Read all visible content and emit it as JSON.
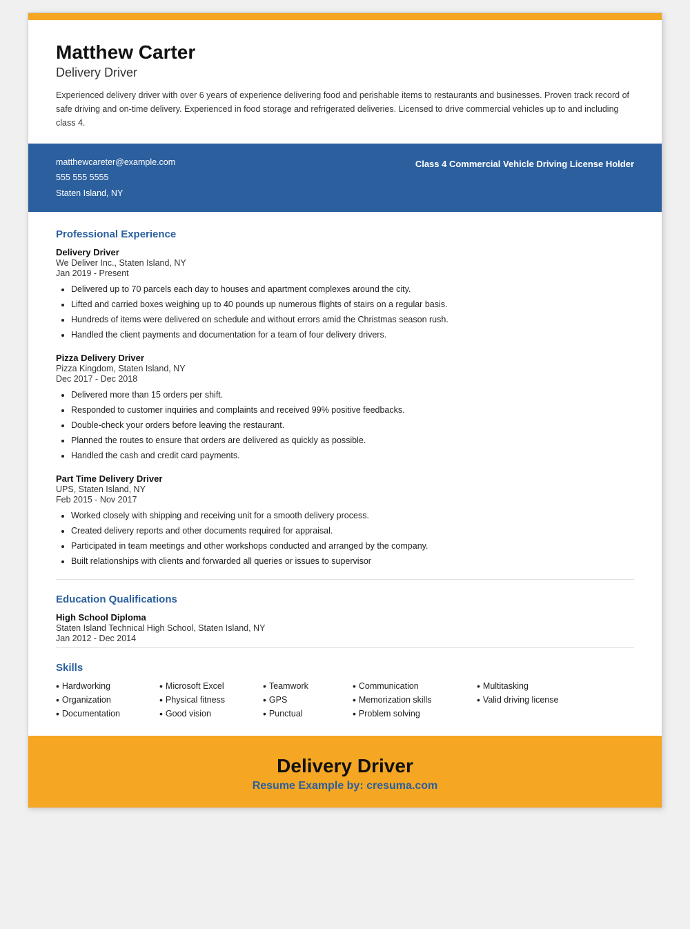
{
  "candidate": {
    "name": "Matthew Carter",
    "title": "Delivery Driver",
    "summary": "Experienced delivery driver with over 6 years of experience delivering food and perishable items to restaurants and businesses. Proven track record of safe driving and on-time delivery. Experienced in food storage and refrigerated deliveries. Licensed to drive commercial vehicles up to and including class 4."
  },
  "contact": {
    "email": "matthewcareter@example.com",
    "phone": "555 555 5555",
    "location": "Staten Island, NY",
    "badge": "Class 4 Commercial Vehicle Driving License Holder"
  },
  "sections": {
    "experience_title": "Professional Experience",
    "education_title": "Education Qualifications",
    "skills_title": "Skills"
  },
  "experience": [
    {
      "job_title": "Delivery Driver",
      "company": "We Deliver Inc., Staten Island, NY",
      "dates": "Jan 2019 - Present",
      "bullets": [
        "Delivered up to 70 parcels each day to houses and apartment complexes around the city.",
        "Lifted and carried boxes weighing up to 40 pounds up numerous flights of stairs on a regular basis.",
        "Hundreds of items were delivered on schedule and without errors amid the Christmas season rush.",
        "Handled the client payments and documentation for a team of four delivery drivers."
      ]
    },
    {
      "job_title": "Pizza Delivery Driver",
      "company": "Pizza Kingdom, Staten Island, NY",
      "dates": "Dec 2017 - Dec 2018",
      "bullets": [
        "Delivered more than 15 orders per shift.",
        "Responded to customer inquiries and complaints and received 99% positive feedbacks.",
        "Double-check your orders before leaving the restaurant.",
        "Planned the routes to ensure that orders are delivered as quickly as possible.",
        "Handled the cash and credit card payments."
      ]
    },
    {
      "job_title": "Part Time Delivery Driver",
      "company": "UPS, Staten Island, NY",
      "dates": "Feb 2015 - Nov 2017",
      "bullets": [
        "Worked closely with shipping and receiving unit for a smooth delivery process.",
        "Created delivery reports and other documents required for appraisal.",
        "Participated in team meetings and other workshops conducted and arranged by the company.",
        "Built relationships with clients and forwarded all queries or issues to supervisor"
      ]
    }
  ],
  "education": [
    {
      "degree": "High School Diploma",
      "school": "Staten Island Technical High School, Staten Island, NY",
      "dates": "Jan 2012 - Dec 2014"
    }
  ],
  "skills": [
    {
      "col": 0,
      "name": "Hardworking"
    },
    {
      "col": 1,
      "name": "Microsoft Excel"
    },
    {
      "col": 2,
      "name": "Teamwork"
    },
    {
      "col": 3,
      "name": "Communication"
    },
    {
      "col": 4,
      "name": "Multitasking"
    },
    {
      "col": 0,
      "name": "Organization"
    },
    {
      "col": 1,
      "name": "Physical fitness"
    },
    {
      "col": 2,
      "name": "GPS"
    },
    {
      "col": 3,
      "name": "Memorization skills"
    },
    {
      "col": 4,
      "name": "Valid driving license"
    },
    {
      "col": 0,
      "name": "Documentation"
    },
    {
      "col": 1,
      "name": "Good vision"
    },
    {
      "col": 2,
      "name": "Punctual"
    },
    {
      "col": 3,
      "name": "Problem solving"
    }
  ],
  "footer": {
    "title": "Delivery Driver",
    "subtitle_text": "Resume Example by:",
    "brand": "cresuma.com"
  }
}
